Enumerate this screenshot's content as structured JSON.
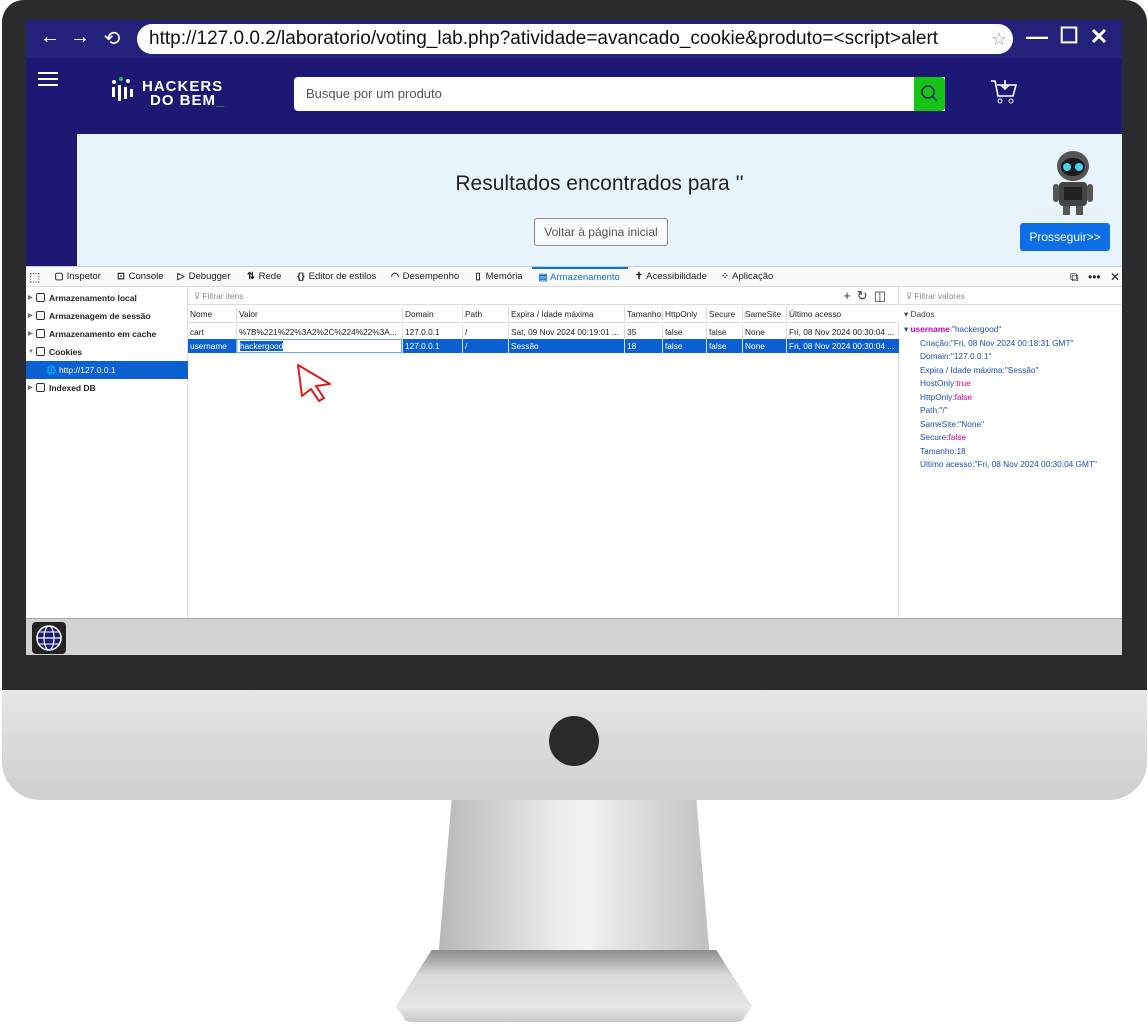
{
  "browser": {
    "url": "http://127.0.0.2/laboratorio/voting_lab.php?atividade=avancado_cookie&produto=<script>alert",
    "back": "←",
    "forward": "→",
    "reload": "⟲",
    "star": "☆",
    "minimize": "—",
    "maximize": "☐",
    "close": "✕"
  },
  "site": {
    "logo_line1": "HACKERS",
    "logo_line2": "DO BEM",
    "logo_cursor": "_",
    "search_placeholder": "Busque por um produto",
    "results_title": "Resultados encontrados para ''",
    "back_button": "Voltar à página inicial",
    "next_button": "Prosseguir>>"
  },
  "devtools": {
    "tabs": [
      "Inspetor",
      "Console",
      "Debugger",
      "Rede",
      "Editor de estilos",
      "Desempenho",
      "Memória",
      "Armazenamento",
      "Acessibilidade",
      "Aplicação"
    ],
    "tab_icons": [
      "▢",
      "⊡",
      "▷",
      "⇅",
      "{}",
      "◠",
      "▯",
      "▤",
      "✝",
      "⁘"
    ],
    "active_tab": "Armazenamento",
    "tree": [
      "Armazenamento local",
      "Armazenagem de sessão",
      "Armazenamento em cache",
      "Cookies",
      "http://127.0.0.1",
      "Indexed DB"
    ],
    "filter_items": "Filtrar itens",
    "filter_values": "Filtrar valores",
    "columns": [
      "Nome",
      "Valor",
      "Domain",
      "Path",
      "Expira / Idade máxima",
      "Tamanho",
      "HttpOnly",
      "Secure",
      "SameSite",
      "Último acesso"
    ],
    "rows": [
      [
        "cart",
        "%7B%221%22%3A2%2C%224%22%3A...",
        "127.0.0.1",
        "/",
        "Sat, 09 Nov 2024 00:19:01 ...",
        "35",
        "false",
        "false",
        "None",
        "Fri, 08 Nov 2024 00:30:04 ..."
      ],
      [
        "username",
        "hackergood",
        "127.0.0.1",
        "/",
        "Sessão",
        "18",
        "false",
        "false",
        "None",
        "Fri, 08 Nov 2024 00:30:04 ..."
      ]
    ],
    "detail": {
      "section": "Dados",
      "root_key": "username",
      "root_val": ":\"hackergood\"",
      "lines": [
        {
          "k": "Criação",
          "v": ":\"Fri, 08 Nov 2024 00:18:31 GMT\""
        },
        {
          "k": "Domain",
          "v": ":\"127.0.0.1\""
        },
        {
          "k": "Expira / Idade máxima",
          "v": ":\"Sessão\""
        },
        {
          "k": "HostOnly",
          "v": ":true"
        },
        {
          "k": "HttpOnly",
          "v": ":false"
        },
        {
          "k": "Path",
          "v": ":\"/\""
        },
        {
          "k": "SameSite",
          "v": ":\"None\""
        },
        {
          "k": "Secure",
          "v": ":false"
        },
        {
          "k": "Tamanho",
          "v": ":18"
        },
        {
          "k": "Último acesso",
          "v": ":\"Fri, 08 Nov 2024 00:30:04 GMT\""
        }
      ]
    }
  },
  "colors": {
    "brand": "#1c1873",
    "accent_green": "#15c414",
    "selection": "#0a60d0",
    "button_blue": "#0d6ee6"
  }
}
